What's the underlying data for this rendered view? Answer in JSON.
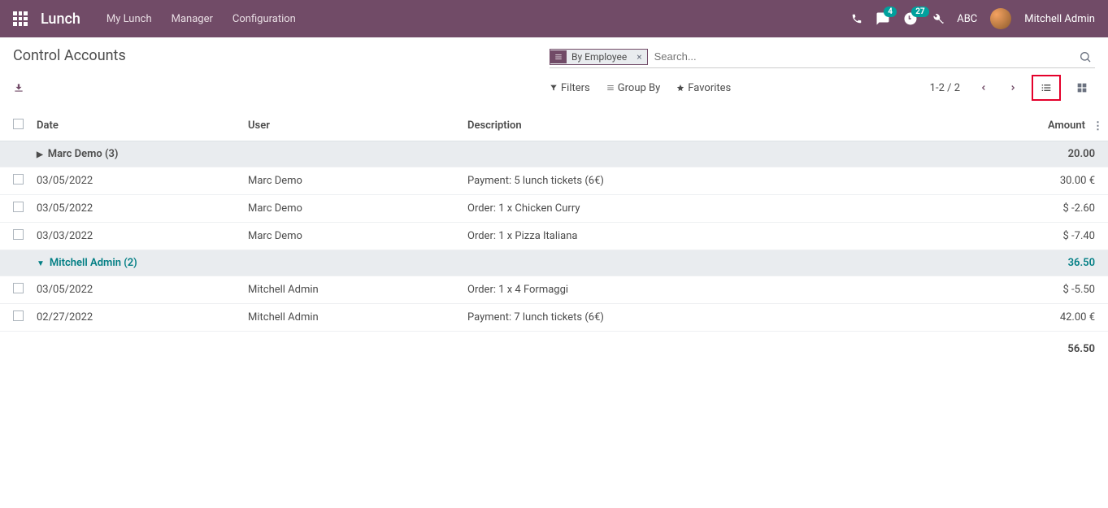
{
  "navbar": {
    "brand": "Lunch",
    "menu": [
      "My Lunch",
      "Manager",
      "Configuration"
    ],
    "messages_badge": "4",
    "activities_badge": "27",
    "debug_label": "ABC",
    "user_name": "Mitchell Admin"
  },
  "header": {
    "title": "Control Accounts",
    "search_facet": "By Employee",
    "search_placeholder": "Search..."
  },
  "toolbar": {
    "filters": "Filters",
    "group_by": "Group By",
    "favorites": "Favorites",
    "pager": "1-2 / 2"
  },
  "table": {
    "columns": {
      "date": "Date",
      "user": "User",
      "description": "Description",
      "amount": "Amount"
    },
    "groups": [
      {
        "name": "Marc Demo (3)",
        "open": false,
        "amount": "20.00",
        "rows": [
          {
            "date": "03/05/2022",
            "user": "Marc Demo",
            "description": "Payment: 5 lunch tickets (6€)",
            "amount": "30.00 €"
          },
          {
            "date": "03/05/2022",
            "user": "Marc Demo",
            "description": "Order: 1 x Chicken Curry",
            "amount": "$ -2.60"
          },
          {
            "date": "03/03/2022",
            "user": "Marc Demo",
            "description": "Order: 1 x Pizza Italiana",
            "amount": "$ -7.40"
          }
        ]
      },
      {
        "name": "Mitchell Admin (2)",
        "open": true,
        "amount": "36.50",
        "rows": [
          {
            "date": "03/05/2022",
            "user": "Mitchell Admin",
            "description": "Order: 1 x 4 Formaggi",
            "amount": "$ -5.50"
          },
          {
            "date": "02/27/2022",
            "user": "Mitchell Admin",
            "description": "Payment: 7 lunch tickets (6€)",
            "amount": "42.00 €"
          }
        ]
      }
    ],
    "total": "56.50"
  }
}
